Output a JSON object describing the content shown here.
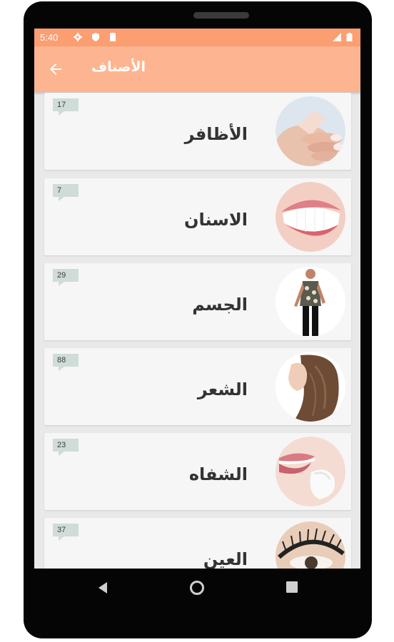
{
  "status": {
    "time": "5:40",
    "icons": [
      "settings-icon",
      "shield-icon",
      "sim-icon",
      "signal-icon",
      "battery-icon"
    ]
  },
  "appbar": {
    "title": "الأصناف",
    "back_icon": "arrow-left-icon"
  },
  "categories": [
    {
      "name": "الأظافر",
      "count": "17",
      "image": "nails"
    },
    {
      "name": "الاسنان",
      "count": "7",
      "image": "teeth"
    },
    {
      "name": "الجسم",
      "count": "29",
      "image": "body"
    },
    {
      "name": "الشعر",
      "count": "88",
      "image": "hair"
    },
    {
      "name": "الشفاه",
      "count": "23",
      "image": "lips"
    },
    {
      "name": "العين",
      "count": "37",
      "image": "eye"
    }
  ],
  "navbar": {
    "back": "triangle-back-icon",
    "home": "circle-home-icon",
    "recents": "square-recents-icon"
  },
  "colors": {
    "statusbar": "#fb9e72",
    "appbar": "#fcb590",
    "badge": "#cfdcd8"
  }
}
